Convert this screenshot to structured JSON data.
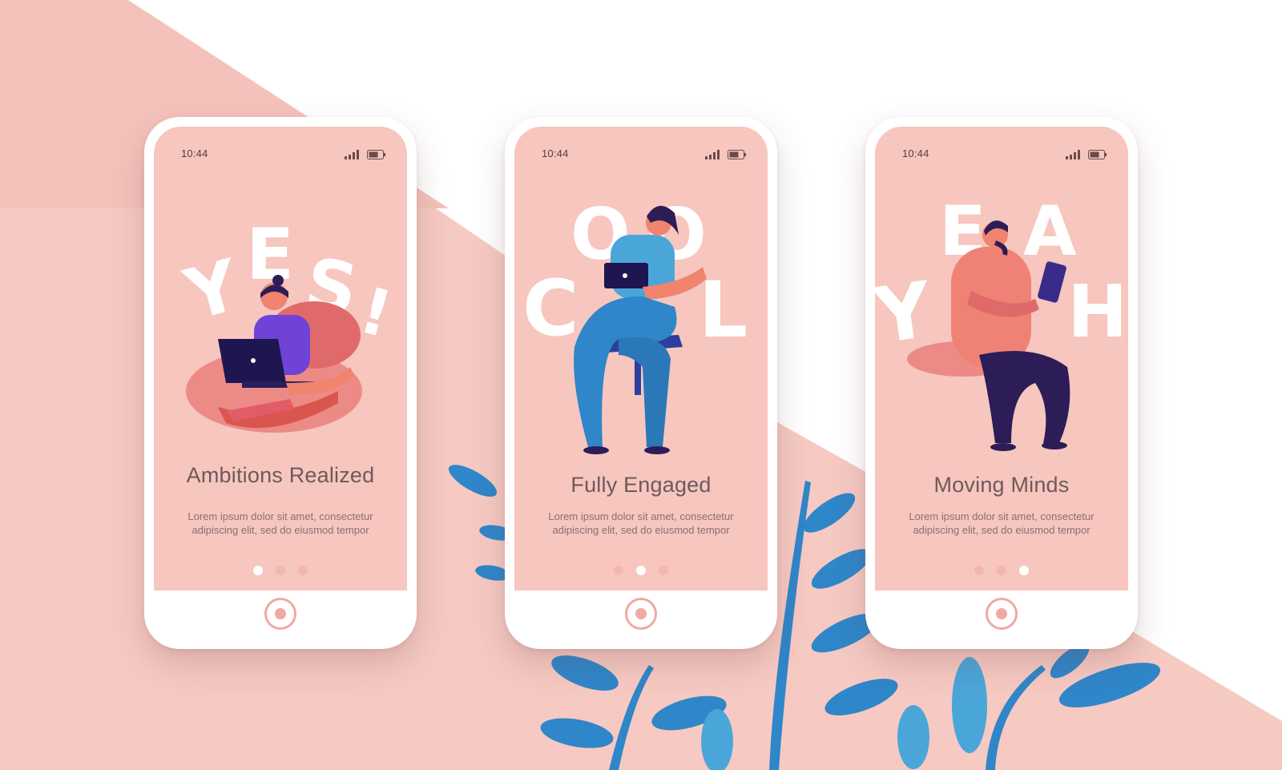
{
  "colors": {
    "background_pink": "#f6c9c3",
    "screen_pink": "#f6c6bf",
    "leaf_blue": "#2f86c9",
    "leaf_light_blue": "#4aa6d9",
    "text_gray": "#6e5a5a"
  },
  "screens": [
    {
      "time": "10:44",
      "big_word": "YES!",
      "title": "Ambitions Realized",
      "body_line1": "Lorem ipsum dolor sit amet, consectetur",
      "body_line2": "adipiscing elit, sed do eiusmod tempor",
      "active_dot": 1,
      "dot_count": 3
    },
    {
      "time": "10:44",
      "big_word": "COOL",
      "title": "Fully Engaged",
      "body_line1": "Lorem ipsum dolor sit amet, consectetur",
      "body_line2": "adipiscing elit, sed do eiusmod tempor",
      "active_dot": 2,
      "dot_count": 3
    },
    {
      "time": "10:44",
      "big_word": "YEAH",
      "title": "Moving Minds",
      "body_line1": "Lorem ipsum dolor sit amet, consectetur",
      "body_line2": "adipiscing elit, sed do eiusmod tempor",
      "active_dot": 3,
      "dot_count": 3
    }
  ],
  "icons": [
    "signal-icon",
    "battery-icon",
    "home-button-icon",
    "leaf-decoration"
  ]
}
